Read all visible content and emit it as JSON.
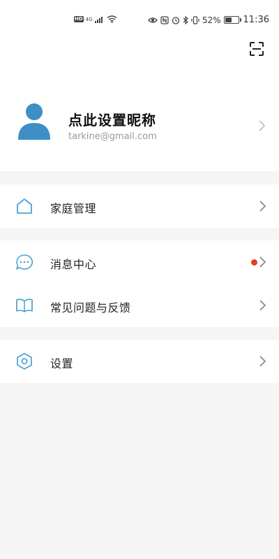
{
  "status_bar": {
    "hd_label": "HD",
    "signal_label": "4G",
    "battery_percent": "52%",
    "battery_level": 0.52,
    "time": "11:36"
  },
  "header": {
    "scan_icon": "scan-icon"
  },
  "profile": {
    "nickname": "点此设置昵称",
    "email": "tarkine@gmail.com",
    "avatar_icon": "user-avatar-icon",
    "avatar_color": "#3d8fc6"
  },
  "menu": {
    "home_management": {
      "label": "家庭管理",
      "icon": "home-icon"
    },
    "message_center": {
      "label": "消息中心",
      "icon": "message-icon",
      "has_unread": true,
      "dot_color": "#e63c1e"
    },
    "faq_feedback": {
      "label": "常见问题与反馈",
      "icon": "book-icon"
    },
    "settings": {
      "label": "设置",
      "icon": "hexagon-settings-icon"
    }
  },
  "colors": {
    "accent": "#4aa3d3",
    "background": "#f5f5f5",
    "card": "#ffffff",
    "chevron": "#8a8a8a"
  }
}
